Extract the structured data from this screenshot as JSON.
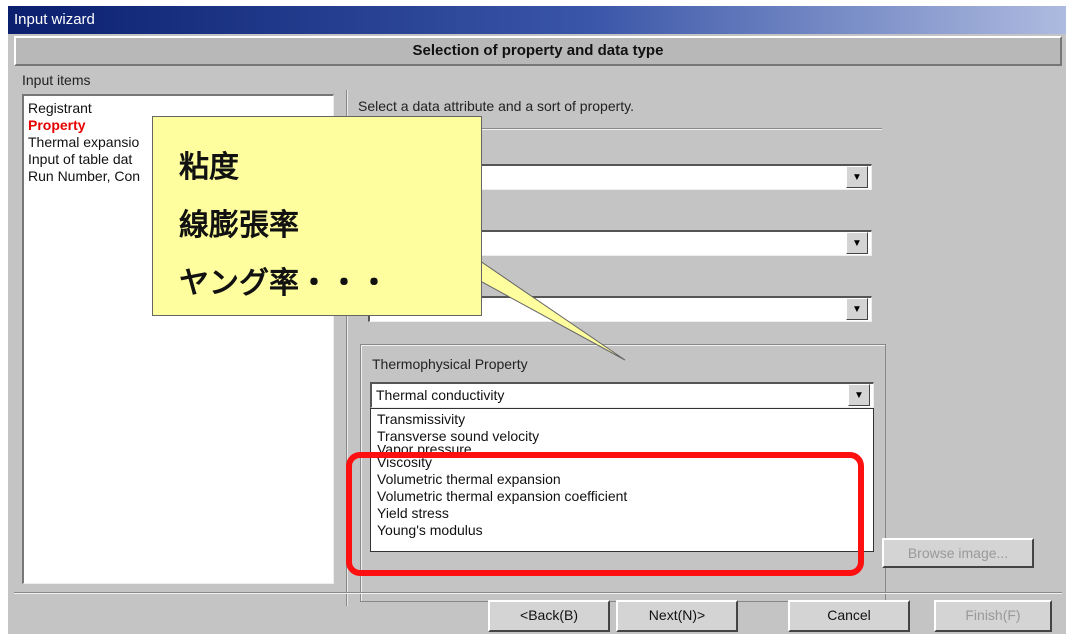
{
  "window": {
    "title": "Input wizard"
  },
  "header": {
    "title": "Selection of property and data type"
  },
  "left_panel": {
    "label": "Input items",
    "items": [
      {
        "label": "Registrant",
        "selected": false
      },
      {
        "label": "Property",
        "selected": true
      },
      {
        "label": "Thermal expansio",
        "selected": false
      },
      {
        "label": "Input of table dat",
        "selected": false
      },
      {
        "label": "Run Number, Con",
        "selected": false
      }
    ]
  },
  "right_panel": {
    "instruction": "Select a data attribute and a sort of property.",
    "thermo_group": {
      "label": "Thermophysical Property",
      "selected_value": "Thermal conductivity",
      "options": [
        "Transmissivity",
        "Transverse sound velocity",
        "Vapor pressure",
        "Viscosity",
        "Volumetric thermal expansion",
        "Volumetric thermal expansion coefficient",
        "Yield stress",
        "Young's modulus"
      ],
      "browse_label": "Browse image..."
    }
  },
  "callout": {
    "lines": [
      "粘度",
      "線膨張率",
      "ヤング率・・・"
    ]
  },
  "footer": {
    "back": "<Back(B)",
    "next": "Next(N)>",
    "cancel": "Cancel",
    "finish": "Finish(F)"
  },
  "colors": {
    "selected_item": "#e60000",
    "highlight": "#ff1010",
    "callout_bg": "#fffe9e"
  },
  "icons": {
    "dropdown": "chevron-down-icon",
    "scroll_up": "arrow-up-icon",
    "scroll_down": "arrow-down-icon"
  }
}
